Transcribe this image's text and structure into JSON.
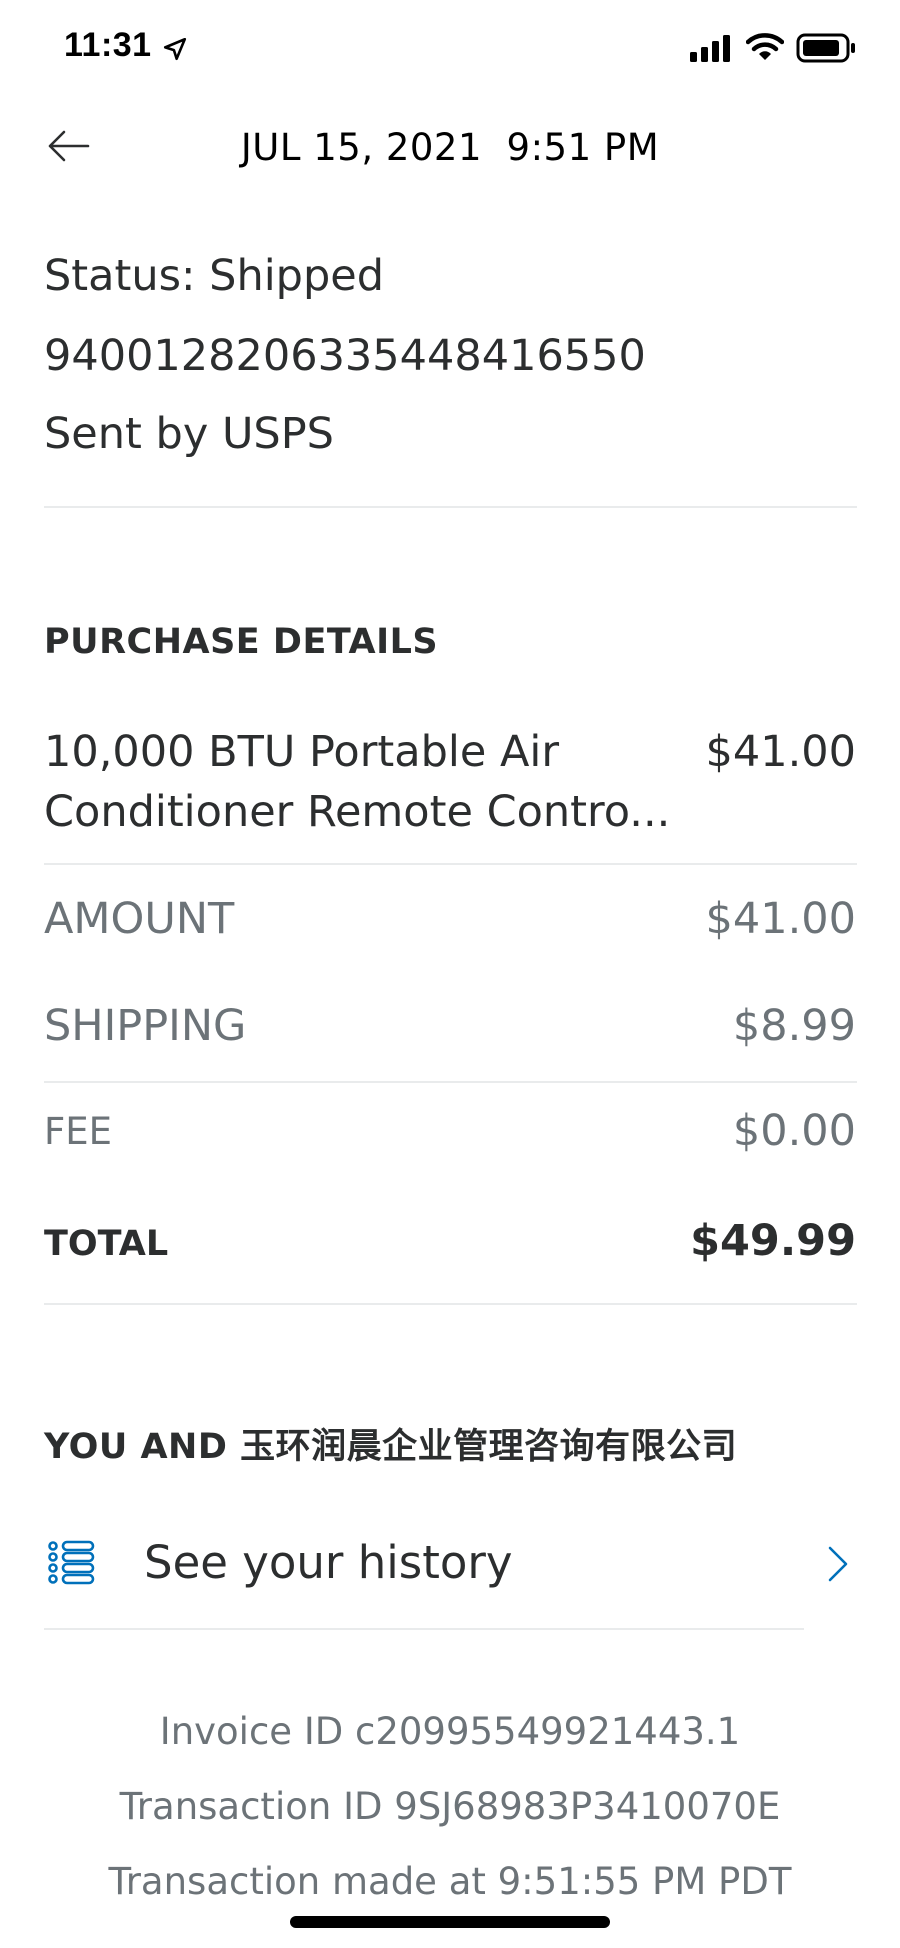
{
  "status_bar": {
    "time": "11:31",
    "icons": [
      "location-arrow-icon",
      "cellular-signal-icon",
      "wifi-icon",
      "battery-icon"
    ]
  },
  "header": {
    "back_icon": "arrow-left-icon",
    "title": "JUL 15, 2021  9:51 PM"
  },
  "shipment": {
    "status": "Status: Shipped",
    "tracking_number": "9400128206335448416550",
    "carrier": "Sent by USPS"
  },
  "purchase_details": {
    "heading": "PURCHASE DETAILS",
    "item_name": "10,000 BTU Portable Air Conditioner Remote Contro...",
    "item_price": "$41.00",
    "amount_label": "AMOUNT",
    "amount_value": "$41.00",
    "shipping_label": "SHIPPING",
    "shipping_value": "$8.99",
    "fee_label": "FEE",
    "fee_value": "$0.00",
    "total_label": "TOTAL",
    "total_value": "$49.99"
  },
  "counterparty": {
    "heading": "YOU AND 玉环润晨企业管理咨询有限公司",
    "history_label": "See your history",
    "history_icon": "list-icon",
    "chevron_icon": "chevron-right-icon"
  },
  "footer": {
    "invoice": "Invoice ID c20995549921443.1",
    "transaction": "Transaction ID 9SJ68983P3410070E",
    "made_at": "Transaction made at 9:51:55 PM PDT"
  },
  "colors": {
    "text_primary": "#2c2e2f",
    "text_secondary": "#6c7378",
    "accent": "#0070ba",
    "divider": "#e9ebec"
  }
}
